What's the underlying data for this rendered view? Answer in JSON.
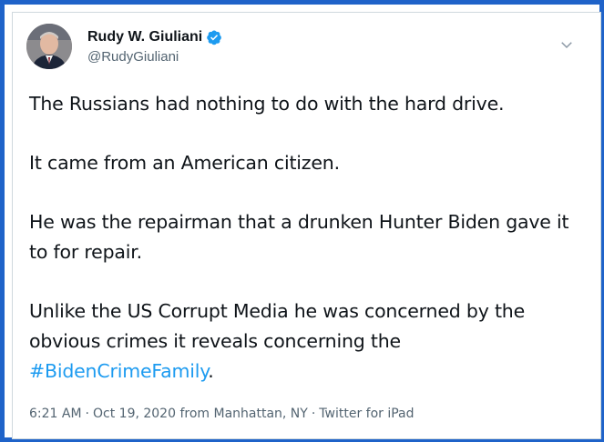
{
  "colors": {
    "frame": "#1f63c9",
    "hashtag": "#1d9bf0",
    "verified": "#1d9bf0",
    "text": "#0f1419",
    "muted": "#536471"
  },
  "author": {
    "display_name": "Rudy W. Giuliani",
    "handle": "@RudyGiuliani",
    "verified_icon": "verified-badge-icon",
    "menu_icon": "chevron-down-icon"
  },
  "tweet": {
    "paragraphs": [
      "The Russians had nothing to do with the hard drive.",
      "It came from an American citizen.",
      "He was the repairman that a drunken Hunter Biden gave it to for repair.",
      "Unlike the US Corrupt Media he was concerned by the obvious crimes it reveals concerning the"
    ],
    "hashtag": "#BidenCrimeFamily",
    "hashtag_suffix": "."
  },
  "meta": {
    "time": "6:21 AM",
    "date": "Oct 19, 2020",
    "location": "from Manhattan, NY",
    "source": "Twitter for iPad",
    "separator": "·"
  }
}
